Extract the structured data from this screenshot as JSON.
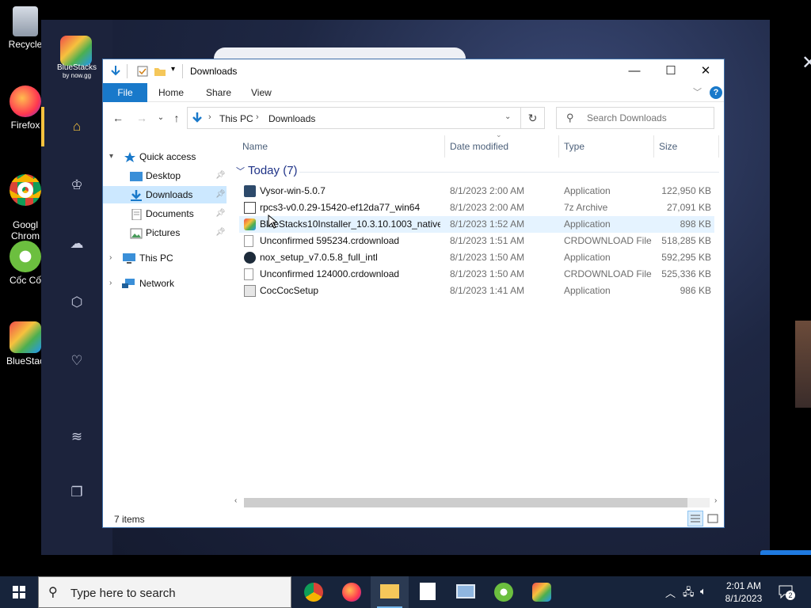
{
  "desktop": {
    "icons": [
      {
        "label": "Recycle"
      },
      {
        "label": "Firefox"
      },
      {
        "label": "Googl\nChrom"
      },
      {
        "label": "Cốc Cố"
      },
      {
        "label": "BlueStac"
      }
    ]
  },
  "bluestacks": {
    "brand": "BlueStacks",
    "by": "by now.gg",
    "close": "✕"
  },
  "explorer": {
    "title": "Downloads",
    "controls": {
      "minimize": "—",
      "maximize": "☐",
      "close": "✕"
    },
    "ribbon": {
      "tabs": [
        "File",
        "Home",
        "Share",
        "View"
      ],
      "help": "?"
    },
    "address": {
      "crumbs": [
        "This PC",
        "Downloads"
      ]
    },
    "search": {
      "placeholder": "Search Downloads"
    },
    "nav": {
      "quick_access": "Quick access",
      "items": [
        {
          "label": "Desktop"
        },
        {
          "label": "Downloads"
        },
        {
          "label": "Documents"
        },
        {
          "label": "Pictures"
        }
      ],
      "this_pc": "This PC",
      "network": "Network"
    },
    "columns": {
      "name": "Name",
      "date": "Date modified",
      "type": "Type",
      "size": "Size"
    },
    "group": "Today (7)",
    "files": [
      {
        "name": "Vysor-win-5.0.7",
        "date": "8/1/2023 2:00 AM",
        "type": "Application",
        "size": "122,950 KB"
      },
      {
        "name": "rpcs3-v0.0.29-15420-ef12da77_win64",
        "date": "8/1/2023 2:00 AM",
        "type": "7z Archive",
        "size": "27,091 KB"
      },
      {
        "name": "BlueStacks10Installer_10.3.10.1003_native...",
        "date": "8/1/2023 1:52 AM",
        "type": "Application",
        "size": "898 KB"
      },
      {
        "name": "Unconfirmed 595234.crdownload",
        "date": "8/1/2023 1:51 AM",
        "type": "CRDOWNLOAD File",
        "size": "518,285 KB"
      },
      {
        "name": "nox_setup_v7.0.5.8_full_intl",
        "date": "8/1/2023 1:50 AM",
        "type": "Application",
        "size": "592,295 KB"
      },
      {
        "name": "Unconfirmed 124000.crdownload",
        "date": "8/1/2023 1:50 AM",
        "type": "CRDOWNLOAD File",
        "size": "525,336 KB"
      },
      {
        "name": "CocCocSetup",
        "date": "8/1/2023 1:41 AM",
        "type": "Application",
        "size": "986 KB"
      }
    ],
    "status": "7 items"
  },
  "taskbar": {
    "search_placeholder": "Type here to search",
    "time": "2:01 AM",
    "date": "8/1/2023",
    "notifications": "2"
  },
  "colors": {
    "accent": "#1979ca",
    "selection": "#cce8ff",
    "taskbar": "#17243b"
  }
}
